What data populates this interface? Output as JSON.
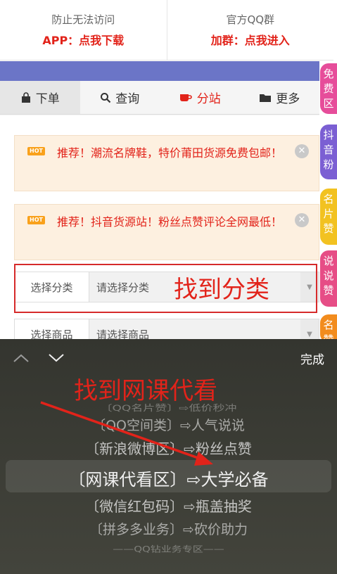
{
  "topbar": {
    "left": {
      "line1": "防止无法访问",
      "line2": "APP：点我下载"
    },
    "right": {
      "line1": "官方QQ群",
      "line2": "加群：点我进入"
    }
  },
  "tabs": [
    {
      "label": "下单",
      "icon": "bag-icon"
    },
    {
      "label": "查询",
      "icon": "search-icon"
    },
    {
      "label": "分站",
      "icon": "cup-icon"
    },
    {
      "label": "更多",
      "icon": "folder-icon"
    }
  ],
  "notices": [
    {
      "badge": "HOT",
      "text": "推荐！潮流名牌鞋，特价莆田货源免费包邮！"
    },
    {
      "badge": "HOT",
      "text": "推荐！抖音货源站！粉丝点赞评论全网最低！"
    }
  ],
  "form": {
    "category_label": "选择分类",
    "category_value": "请选择分类",
    "product_label": "选择商品",
    "product_value": "请选择商品"
  },
  "annotations": {
    "find_category": "找到分类",
    "find_course": "找到网课代看"
  },
  "side_tabs": [
    {
      "label": "免费区",
      "color": "#e64d9a"
    },
    {
      "label": "抖音粉",
      "color": "#7b5fd3"
    },
    {
      "label": "名片赞",
      "color": "#f2c221"
    },
    {
      "label": "说说赞",
      "color": "#e64d86"
    },
    {
      "label": "名赞",
      "color": "#f28c1e"
    }
  ],
  "picker": {
    "done_label": "完成",
    "options": [
      "〔QQ名片赞〕⇨低价秒冲",
      "〔QQ空间类〕⇨人气说说",
      "〔新浪微博区〕⇨粉丝点赞",
      "〔网课代看区〕⇨大学必备",
      "〔微信红包码〕⇨瓶盖抽奖",
      "〔拼多多业务〕⇨砍价助力",
      "——QQ钻业务专区——"
    ],
    "selected": "〔网课代看区〕⇨大学必备"
  },
  "colors": {
    "accent_red": "#e2231a",
    "purple": "#6b75c7",
    "notice_bg": "#fdf0e0"
  }
}
